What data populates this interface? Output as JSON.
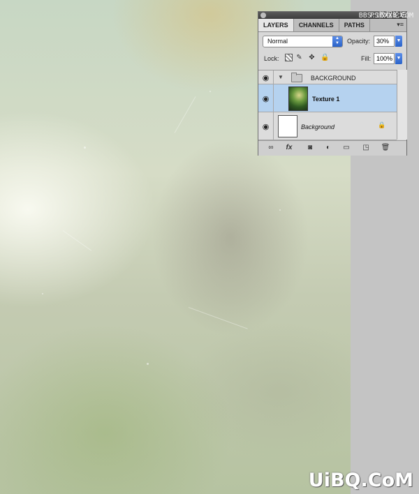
{
  "panel": {
    "tabs": [
      {
        "label": "LAYERS",
        "active": true
      },
      {
        "label": "CHANNELS",
        "active": false
      },
      {
        "label": "PATHS",
        "active": false
      }
    ],
    "menu_icon": "panel-menu-icon",
    "blend_mode": "Normal",
    "opacity_label": "Opacity:",
    "opacity_value": "30%",
    "lock_label": "Lock:",
    "fill_label": "Fill:",
    "fill_value": "100%",
    "layers": [
      {
        "name": "BACKGROUND",
        "type": "group",
        "expanded": true,
        "visible": true
      },
      {
        "name": "Texture 1",
        "type": "layer",
        "selected": true,
        "visible": true
      },
      {
        "name": "Background",
        "type": "layer",
        "locked": true,
        "visible": true
      }
    ],
    "bottom_icons": [
      "link-icon",
      "fx-icon",
      "mask-icon",
      "adjustment-icon",
      "folder-icon",
      "new-layer-icon",
      "trash-icon"
    ],
    "fx_label": "fx"
  },
  "watermarks": {
    "top_line1": "PS教程论坛",
    "top_line2": "BBS.16XX8.COM",
    "bottom": "UiBQ.CoM"
  },
  "colors": {
    "selection": "#b5d2ef",
    "accent_blue": "#2a63c9"
  }
}
